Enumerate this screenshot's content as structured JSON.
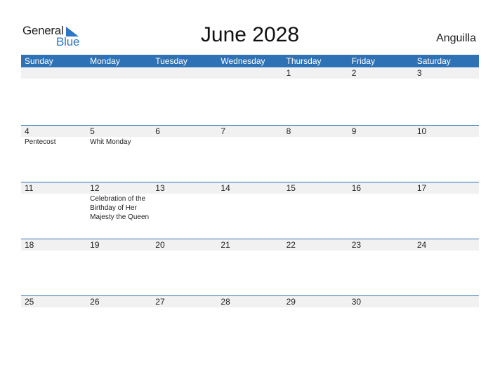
{
  "logo": {
    "word1": "General",
    "word2": "Blue"
  },
  "title": "June 2028",
  "country": "Anguilla",
  "colors": {
    "header_bg": "#2e72b5",
    "logo_blue": "#2e75c5",
    "band": "#f1f1f1"
  },
  "weekdays": [
    "Sunday",
    "Monday",
    "Tuesday",
    "Wednesday",
    "Thursday",
    "Friday",
    "Saturday"
  ],
  "weeks": [
    [
      {
        "day": ""
      },
      {
        "day": ""
      },
      {
        "day": ""
      },
      {
        "day": ""
      },
      {
        "day": "1"
      },
      {
        "day": "2"
      },
      {
        "day": "3"
      }
    ],
    [
      {
        "day": "4",
        "event": "Pentecost"
      },
      {
        "day": "5",
        "event": "Whit Monday"
      },
      {
        "day": "6"
      },
      {
        "day": "7"
      },
      {
        "day": "8"
      },
      {
        "day": "9"
      },
      {
        "day": "10"
      }
    ],
    [
      {
        "day": "11"
      },
      {
        "day": "12",
        "event": "Celebration of the Birthday of Her Majesty the Queen"
      },
      {
        "day": "13"
      },
      {
        "day": "14"
      },
      {
        "day": "15"
      },
      {
        "day": "16"
      },
      {
        "day": "17"
      }
    ],
    [
      {
        "day": "18"
      },
      {
        "day": "19"
      },
      {
        "day": "20"
      },
      {
        "day": "21"
      },
      {
        "day": "22"
      },
      {
        "day": "23"
      },
      {
        "day": "24"
      }
    ],
    [
      {
        "day": "25"
      },
      {
        "day": "26"
      },
      {
        "day": "27"
      },
      {
        "day": "28"
      },
      {
        "day": "29"
      },
      {
        "day": "30"
      },
      {
        "day": ""
      }
    ]
  ]
}
